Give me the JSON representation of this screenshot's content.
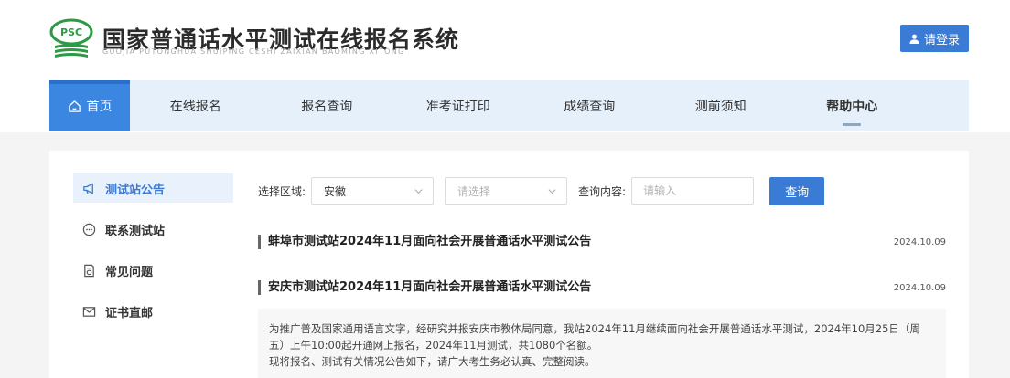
{
  "header": {
    "logo_text": "PSC",
    "title": "国家普通话水平测试在线报名系统",
    "subtitle": "GUOJIA PUTONGHUA SHUIPING CESHI ZAIXIAN BAOMING XITONG",
    "login_label": "请登录"
  },
  "nav": {
    "items": [
      {
        "label": "首页"
      },
      {
        "label": "在线报名"
      },
      {
        "label": "报名查询"
      },
      {
        "label": "准考证打印"
      },
      {
        "label": "成绩查询"
      },
      {
        "label": "测前须知"
      },
      {
        "label": "帮助中心"
      }
    ]
  },
  "sidebar": {
    "items": [
      {
        "label": "测试站公告"
      },
      {
        "label": "联系测试站"
      },
      {
        "label": "常见问题"
      },
      {
        "label": "证书直邮"
      }
    ]
  },
  "filter": {
    "region_label": "选择区域:",
    "province_value": "安徽",
    "city_placeholder": "请选择",
    "query_label": "查询内容:",
    "query_placeholder": "请输入",
    "search_button": "查询"
  },
  "notices": [
    {
      "title": "蚌埠市测试站2024年11月面向社会开展普通话水平测试公告",
      "date": "2024.10.09"
    },
    {
      "title": "安庆市测试站2024年11月面向社会开展普通话水平测试公告",
      "date": "2024.10.09"
    }
  ],
  "summary": {
    "line1": "为推广普及国家通用语言文字，经研究并报安庆市教体局同意，我站2024年11月继续面向社会开展普通话水平测试，2024年10月25日（周五）上午10:00起开通网上报名，2024年11月测试，共1080个名额。",
    "line2": "现将报名、测试有关情况公告如下，请广大考生务必认真、完整阅读。"
  },
  "colors": {
    "primary": "#3a7bd5",
    "nav_bg": "#e6f0fb",
    "logo_green": "#2e9a46"
  }
}
